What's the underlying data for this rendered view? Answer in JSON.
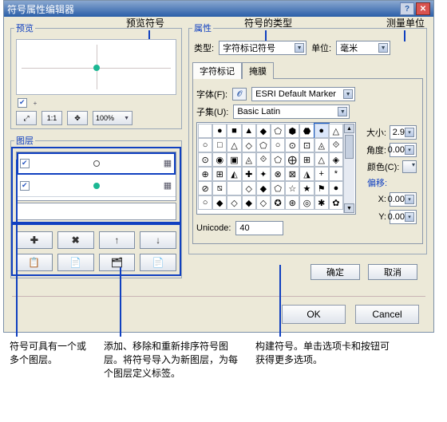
{
  "window": {
    "title": "符号属性编辑器"
  },
  "top_callouts": {
    "preview": "预览符号",
    "type": "符号的类型",
    "unit": "测量单位"
  },
  "preview": {
    "legend": "预览",
    "zoom": "100%",
    "tool_expand": "⤢",
    "tool_one": "1:1",
    "tool_contract": "✥"
  },
  "layers": {
    "legend": "图层",
    "rows": [
      {
        "checked": true,
        "style": "open"
      },
      {
        "checked": true,
        "style": "fill"
      }
    ],
    "btns1": [
      "✚",
      "✖",
      "↑",
      "↓"
    ],
    "btns2": [
      "📋",
      "📄",
      "🗂",
      "📄"
    ]
  },
  "props": {
    "legend": "属性",
    "type_label": "类型:",
    "type_value": "字符标记符号",
    "unit_label": "单位:",
    "unit_value": "毫米",
    "tabs": {
      "a": "字符标记",
      "b": "掩膜"
    },
    "font_label": "字体(F):",
    "font_value": "ESRI Default Marker",
    "subset_label": "子集(U):",
    "subset_value": "Basic Latin",
    "size_label": "大小:",
    "size_value": "2.9",
    "angle_label": "角度:",
    "angle_value": "0.00",
    "color_label": "颜色(C):",
    "offset_label": "偏移:",
    "offx_label": "X:",
    "offx_value": "0.00",
    "offy_label": "Y:",
    "offy_value": "0.00",
    "unicode_label": "Unicode:",
    "unicode_value": "40",
    "glyphs": [
      "",
      "●",
      "■",
      "▲",
      "◆",
      "⬠",
      "⬢",
      "⬣",
      "●",
      "△",
      "○",
      "□",
      "△",
      "◇",
      "⬠",
      "○",
      "⊙",
      "⊡",
      "◬",
      "⟐",
      "⊙",
      "◉",
      "▣",
      "◬",
      "⟐",
      "⬠",
      "⨁",
      "⊞",
      "△",
      "◈",
      "⊕",
      "⊞",
      "◭",
      "✚",
      "✦",
      "⊗",
      "⊠",
      "◮",
      "+",
      "*",
      "⊘",
      "⧅",
      "",
      "◇",
      "◆",
      "⬠",
      "☆",
      "★",
      "⚑",
      "●",
      "○",
      "◆",
      "◇",
      "◆",
      "◇",
      "✪",
      "⊛",
      "◎",
      "✱",
      "✿"
    ]
  },
  "dlg_buttons": {
    "ok": "确定",
    "cancel": "取消"
  },
  "outer_buttons": {
    "ok": "OK",
    "cancel": "Cancel"
  },
  "bottom_callouts": {
    "layers": "符号可具有一个或多个图层。",
    "btns": "添加、移除和重新排序符号图层。将符号导入为新图层，为每个图层定义标签。",
    "build": "构建符号。单击选项卡和按钮可获得更多选项。"
  }
}
